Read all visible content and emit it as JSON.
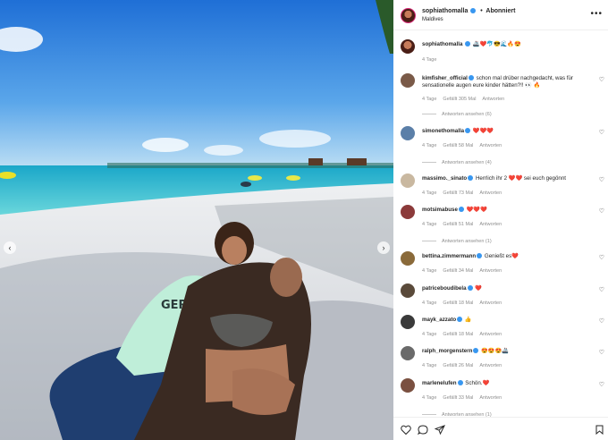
{
  "post": {
    "username": "sophiathomalla",
    "follow_label": "Abonniert",
    "location": "Maldives",
    "caption_emojis": "🚢❤️🐬😎🌊🔥😍",
    "caption_age": "4 Tage"
  },
  "comments": [
    {
      "user": "kimfisher_official",
      "text": "schon mal drüber nachgedacht, was für sensationelle augen eure kinder hätten?!! 👀 🔥",
      "age": "4 Tage",
      "likes": "Gefällt 305 Mal",
      "reply": "Antworten",
      "replies": "Antworten ansehen (6)",
      "avatar": "#7a5a48"
    },
    {
      "user": "simonethomalla",
      "text": "❤️❤️❤️",
      "age": "4 Tage",
      "likes": "Gefällt 58 Mal",
      "reply": "Antworten",
      "replies": "Antworten ansehen (4)",
      "avatar": "#5b7fa8"
    },
    {
      "user": "massimo._sinato",
      "text": "Herrlich ihr 2 ❤️❤️ sei euch gegönnt",
      "age": "4 Tage",
      "likes": "Gefällt 73 Mal",
      "reply": "Antworten",
      "replies": "",
      "avatar": "#c9b8a0"
    },
    {
      "user": "motsimabuse",
      "text": "❤️❤️❤️",
      "age": "4 Tage",
      "likes": "Gefällt 51 Mal",
      "reply": "Antworten",
      "replies": "Antworten ansehen (1)",
      "avatar": "#8b3a3a"
    },
    {
      "user": "bettina.zimmermann",
      "text": "Genießt es❤️",
      "age": "4 Tage",
      "likes": "Gefällt 34 Mal",
      "reply": "Antworten",
      "replies": "",
      "avatar": "#8a6a3a"
    },
    {
      "user": "patriceboudibela",
      "text": "❤️",
      "age": "4 Tage",
      "likes": "Gefällt 18 Mal",
      "reply": "Antworten",
      "replies": "",
      "avatar": "#5a4a3a"
    },
    {
      "user": "mayk_azzato",
      "text": "👍",
      "age": "4 Tage",
      "likes": "Gefällt 18 Mal",
      "reply": "Antworten",
      "replies": "",
      "avatar": "#3a3a3a"
    },
    {
      "user": "ralph_morgenstern",
      "text": "😍😍😍🚢",
      "age": "4 Tage",
      "likes": "Gefällt 26 Mal",
      "reply": "Antworten",
      "replies": "",
      "avatar": "#6a6a6a"
    },
    {
      "user": "marlenelufen",
      "text": "Schön.❤️",
      "age": "4 Tage",
      "likes": "Gefällt 33 Mal",
      "reply": "Antworten",
      "replies": "Antworten ansehen (1)",
      "avatar": "#7a5040"
    }
  ],
  "icons": {
    "more": "more-options-icon",
    "like": "heart-icon",
    "comment": "comment-icon",
    "share": "share-icon",
    "save": "bookmark-icon"
  },
  "colors": {
    "verified": "#3897f0",
    "text": "#262626",
    "meta": "#8e8e8e"
  }
}
